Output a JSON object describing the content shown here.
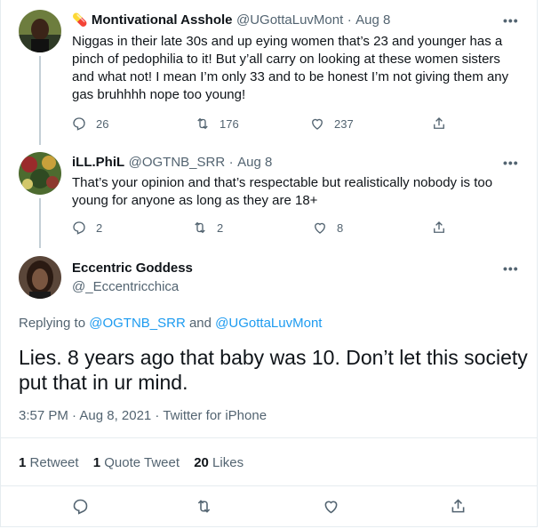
{
  "tweet1": {
    "emoji": "💊",
    "name": "Montivational Asshole",
    "handle": "@UGottaLuvMont",
    "dot": "·",
    "date": "Aug 8",
    "text": "Niggas in their late 30s and up eying women that’s 23 and younger has a pinch of pedophilia to it! But y’all carry on looking at these women sisters and what not! I mean I’m only 33 and to be honest I’m not giving them any gas bruhhhh nope too young!",
    "replies": "26",
    "retweets": "176",
    "likes": "237"
  },
  "tweet2": {
    "name": "iLL.PhiL",
    "handle": "@OGTNB_SRR",
    "dot": "·",
    "date": "Aug 8",
    "text": "That’s your opinion and that’s respectable but realistically nobody is too young for anyone as long as they are 18+",
    "replies": "2",
    "retweets": "2",
    "likes": "8"
  },
  "main": {
    "name": "Eccentric Goddess",
    "handle": "@_Eccentricchica",
    "replying_prefix": "Replying to",
    "reply_to_1": "@OGTNB_SRR",
    "and": "and",
    "reply_to_2": "@UGottaLuvMont",
    "text": "Lies. 8 years ago that baby was 10. Don’t let this society put that in ur mind.",
    "timestamp": "3:57 PM · Aug 8, 2021 · Twitter for iPhone",
    "retweets_count": "1",
    "retweets_label": "Retweet",
    "quotes_count": "1",
    "quotes_label": "Quote Tweet",
    "likes_count": "20",
    "likes_label": "Likes"
  },
  "more_glyph": "•••",
  "icons": [
    "reply-icon",
    "retweet-icon",
    "like-icon",
    "share-icon",
    "more-icon"
  ],
  "colors": {
    "accent": "#1d9bf0",
    "muted": "#536471",
    "divider": "#e6ecf0"
  }
}
